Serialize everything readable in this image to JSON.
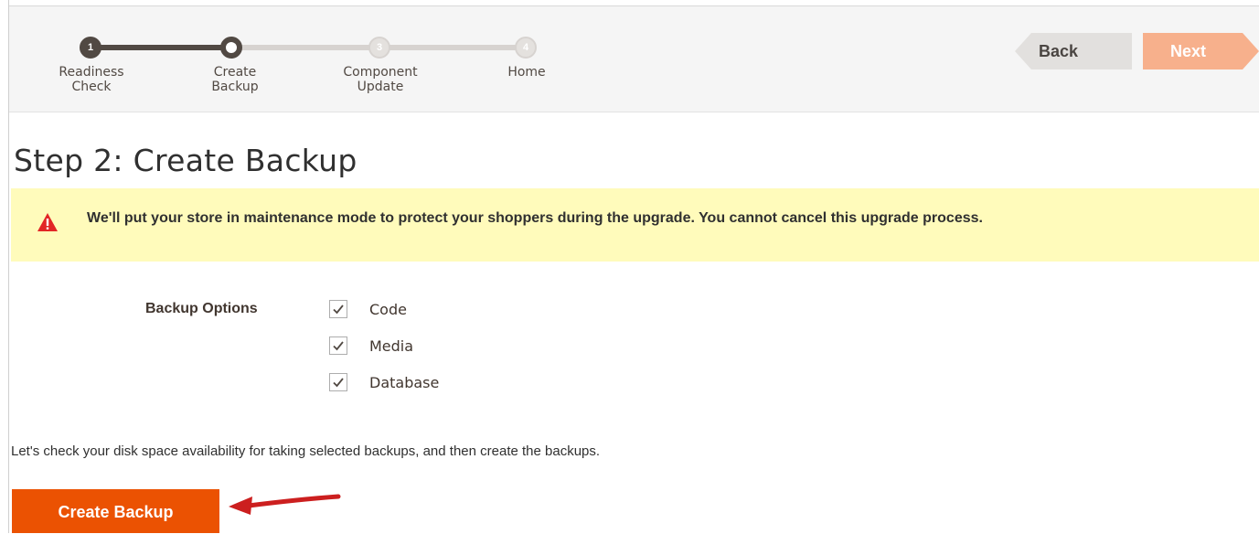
{
  "wizard": {
    "steps": [
      {
        "number": "1",
        "label_line1": "Readiness",
        "label_line2": "Check",
        "state": "done"
      },
      {
        "number": "",
        "label_line1": "Create",
        "label_line2": "Backup",
        "state": "current"
      },
      {
        "number": "3",
        "label_line1": "Component",
        "label_line2": "Update",
        "state": "todo"
      },
      {
        "number": "4",
        "label_line1": "Home",
        "label_line2": "",
        "state": "todo"
      }
    ],
    "back_label": "Back",
    "next_label": "Next"
  },
  "page": {
    "title": "Step 2: Create Backup"
  },
  "notice": {
    "icon": "warning-icon",
    "text": "We'll put your store in maintenance mode to protect your shoppers during the upgrade. You cannot cancel this upgrade process."
  },
  "backup_options": {
    "label": "Backup Options",
    "options": [
      {
        "label": "Code",
        "checked": true
      },
      {
        "label": "Media",
        "checked": true
      },
      {
        "label": "Database",
        "checked": true
      }
    ]
  },
  "hint": "Let's check your disk space availability for taking selected backups, and then create the backups.",
  "create_button_label": "Create Backup",
  "colors": {
    "accent": "#eb5202",
    "next_disabled": "#f7b08c",
    "notice_bg": "#fffbbb",
    "warning": "#e22626",
    "progress_done": "#514943"
  }
}
